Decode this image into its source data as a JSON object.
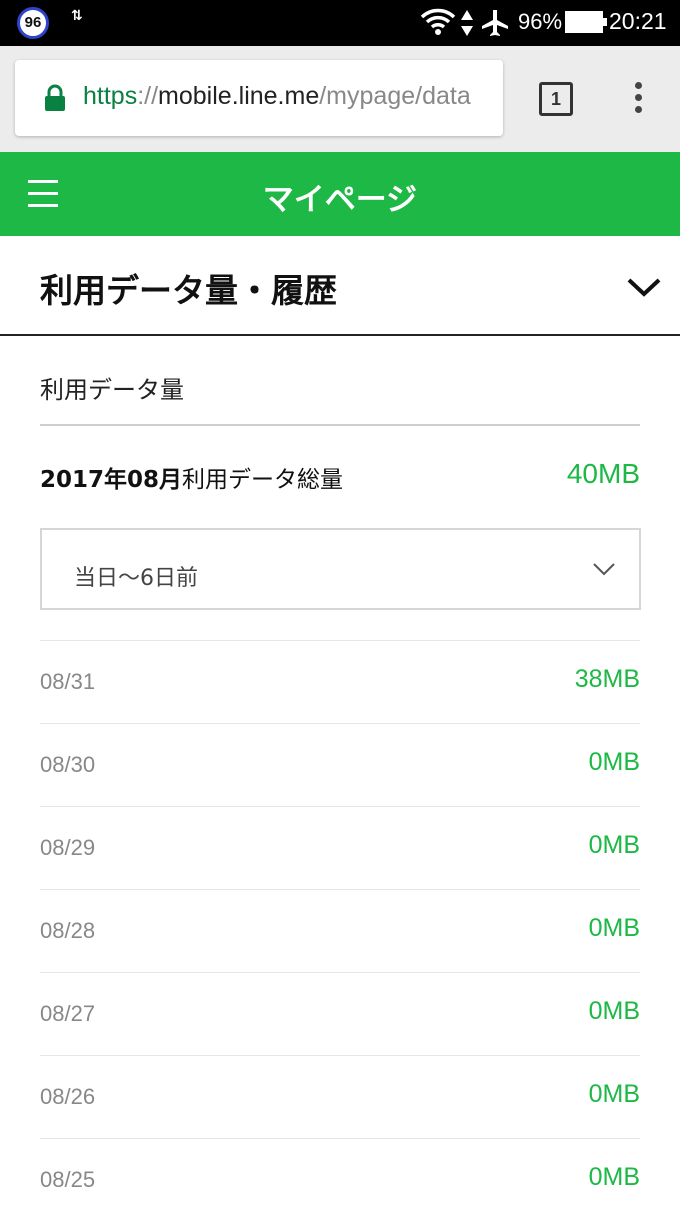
{
  "status_bar": {
    "notification_badge": "96",
    "battery_percent": "96%",
    "time": "20:21",
    "icons": [
      "data-activity-icon",
      "wifi-icon",
      "up-down-arrows-icon",
      "airplane-icon",
      "battery-icon"
    ]
  },
  "browser": {
    "url_scheme": "https",
    "url_separator": "://",
    "url_host": "mobile.line.me",
    "url_path": "/mypage/data",
    "tab_count": "1"
  },
  "header": {
    "title": "マイページ"
  },
  "section": {
    "title": "利用データ量・履歴"
  },
  "usage": {
    "label": "利用データ量",
    "total_period": "2017年08月",
    "total_label": "利用データ総量",
    "total_value": "40MB",
    "range_select": "当日～6日前",
    "rows": [
      {
        "date": "08/31",
        "value": "38MB"
      },
      {
        "date": "08/30",
        "value": "0MB"
      },
      {
        "date": "08/29",
        "value": "0MB"
      },
      {
        "date": "08/28",
        "value": "0MB"
      },
      {
        "date": "08/27",
        "value": "0MB"
      },
      {
        "date": "08/26",
        "value": "0MB"
      },
      {
        "date": "08/25",
        "value": "0MB"
      }
    ]
  },
  "colors": {
    "brand_green": "#1db845",
    "url_green": "#0b8043"
  }
}
